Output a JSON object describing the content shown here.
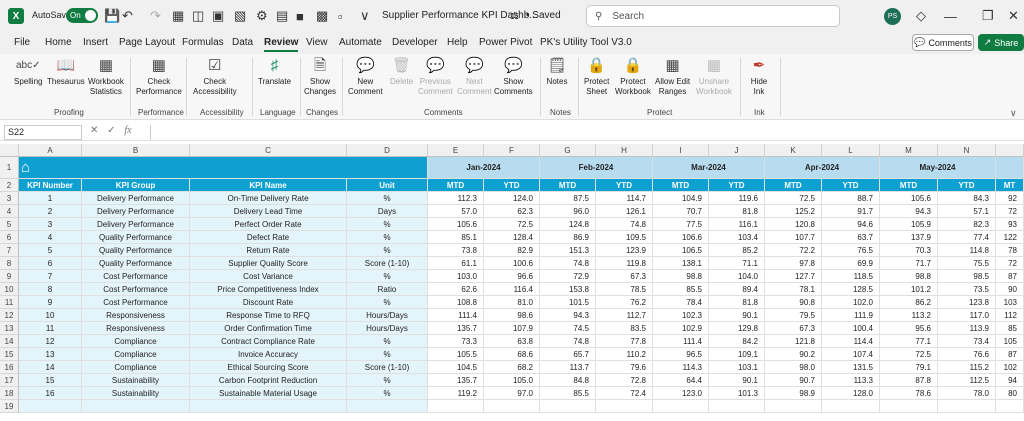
{
  "titlebar": {
    "app_logo": "X",
    "autosave_label": "AutoSave",
    "autosave_state": "On",
    "doc_title": "Supplier Performance KPI Dashb...",
    "saved_status": "• Saved",
    "search_placeholder": "Search",
    "avatar_initials": "PS"
  },
  "menu": [
    "File",
    "Home",
    "Insert",
    "Page Layout",
    "Formulas",
    "Data",
    "Review",
    "View",
    "Automate",
    "Developer",
    "Help",
    "Power Pivot",
    "PK's Utility Tool V3.0"
  ],
  "comments_label": "Comments",
  "share_label": "Share",
  "ribbon": {
    "spelling": "Spelling",
    "thesaurus": "Thesaurus",
    "workbook_stats_1": "Workbook",
    "workbook_stats_2": "Statistics",
    "check_perf_1": "Check",
    "check_perf_2": "Performance",
    "check_access_1": "Check",
    "check_access_2": "Accessibility",
    "translate": "Translate",
    "show_changes_1": "Show",
    "show_changes_2": "Changes",
    "new_comment_1": "New",
    "new_comment_2": "Comment",
    "delete": "Delete",
    "previous_1": "Previous",
    "previous_2": "Comment",
    "next_1": "Next",
    "next_2": "Comment",
    "show_comments_1": "Show",
    "show_comments_2": "Comments",
    "notes": "Notes",
    "protect_sheet_1": "Protect",
    "protect_sheet_2": "Sheet",
    "protect_wb_1": "Protect",
    "protect_wb_2": "Workbook",
    "allow_edit_1": "Allow Edit",
    "allow_edit_2": "Ranges",
    "unshare_1": "Unshare",
    "unshare_2": "Workbook",
    "hide_ink_1": "Hide",
    "hide_ink_2": "Ink",
    "groups": {
      "proofing": "Proofing",
      "performance": "Performance",
      "accessibility": "Accessibility",
      "language": "Language",
      "changes": "Changes",
      "comments": "Comments",
      "notes": "Notes",
      "protect": "Protect",
      "ink": "Ink"
    }
  },
  "formula_bar": {
    "name_box": "S22",
    "fx": "fx"
  },
  "columns": [
    "A",
    "B",
    "C",
    "D",
    "E",
    "F",
    "G",
    "H",
    "I",
    "J",
    "K",
    "L",
    "M",
    "N"
  ],
  "rows": [
    "1",
    "2",
    "3",
    "4",
    "5",
    "6",
    "7",
    "8",
    "9",
    "10",
    "11",
    "12",
    "13",
    "14",
    "15",
    "16",
    "17",
    "18",
    "19"
  ],
  "months": [
    "Jan-2024",
    "Feb-2024",
    "Mar-2024",
    "Apr-2024",
    "May-2024"
  ],
  "header": [
    "KPI Number",
    "KPI Group",
    "KPI Name",
    "Unit",
    "MTD",
    "YTD",
    "MTD",
    "YTD",
    "MTD",
    "YTD",
    "MTD",
    "YTD",
    "MTD",
    "YTD",
    "MT"
  ],
  "table": [
    [
      "1",
      "Delivery Performance",
      "On-Time Delivery Rate",
      "%",
      "112.3",
      "124.0",
      "87.5",
      "114.7",
      "104.9",
      "119.6",
      "72.5",
      "88.7",
      "105.6",
      "84.3",
      "92"
    ],
    [
      "2",
      "Delivery Performance",
      "Delivery Lead Time",
      "Days",
      "57.0",
      "62.3",
      "96.0",
      "126.1",
      "70.7",
      "81.8",
      "125.2",
      "91.7",
      "94.3",
      "57.1",
      "72"
    ],
    [
      "3",
      "Delivery Performance",
      "Perfect Order Rate",
      "%",
      "105.6",
      "72.5",
      "124.8",
      "74.8",
      "77.5",
      "116.1",
      "120.8",
      "94.6",
      "105.9",
      "82.3",
      "93"
    ],
    [
      "4",
      "Quality Performance",
      "Defect Rate",
      "%",
      "85.1",
      "128.4",
      "86.9",
      "109.5",
      "106.6",
      "103.4",
      "107.7",
      "63.7",
      "137.9",
      "77.4",
      "122"
    ],
    [
      "5",
      "Quality Performance",
      "Return Rate",
      "%",
      "73.8",
      "82.9",
      "151.3",
      "123.9",
      "106.5",
      "85.2",
      "72.2",
      "76.5",
      "70.3",
      "114.8",
      "78"
    ],
    [
      "6",
      "Quality Performance",
      "Supplier Quality Score",
      "Score (1-10)",
      "61.1",
      "100.6",
      "74.8",
      "119.8",
      "138.1",
      "71.1",
      "97.8",
      "69.9",
      "71.7",
      "75.5",
      "72"
    ],
    [
      "7",
      "Cost Performance",
      "Cost Variance",
      "%",
      "103.0",
      "96.6",
      "72.9",
      "67.3",
      "98.8",
      "104.0",
      "127.7",
      "118.5",
      "98.8",
      "98.5",
      "87"
    ],
    [
      "8",
      "Cost Performance",
      "Price Competitiveness Index",
      "Ratio",
      "62.6",
      "116.4",
      "153.8",
      "78.5",
      "85.5",
      "89.4",
      "78.1",
      "128.5",
      "101.2",
      "73.5",
      "90"
    ],
    [
      "9",
      "Cost Performance",
      "Discount Rate",
      "%",
      "108.8",
      "81.0",
      "101.5",
      "76.2",
      "78.4",
      "81.8",
      "90.8",
      "102.0",
      "86.2",
      "123.8",
      "103"
    ],
    [
      "10",
      "Responsiveness",
      "Response Time to RFQ",
      "Hours/Days",
      "111.4",
      "98.6",
      "94.3",
      "112.7",
      "102.3",
      "90.1",
      "79.5",
      "111.9",
      "113.2",
      "117.0",
      "112"
    ],
    [
      "11",
      "Responsiveness",
      "Order Confirmation Time",
      "Hours/Days",
      "135.7",
      "107.9",
      "74.5",
      "83.5",
      "102.9",
      "129.8",
      "67.3",
      "100.4",
      "95.6",
      "113.9",
      "85"
    ],
    [
      "12",
      "Compliance",
      "Contract Compliance Rate",
      "%",
      "73.3",
      "63.8",
      "74.8",
      "77.8",
      "111.4",
      "84.2",
      "121.8",
      "114.4",
      "77.1",
      "73.4",
      "105"
    ],
    [
      "13",
      "Compliance",
      "Invoice Accuracy",
      "%",
      "105.5",
      "68.6",
      "65.7",
      "110.2",
      "96.5",
      "109.1",
      "90.2",
      "107.4",
      "72.5",
      "76.6",
      "87"
    ],
    [
      "14",
      "Compliance",
      "Ethical Sourcing Score",
      "Score (1-10)",
      "104.5",
      "68.2",
      "113.7",
      "79.6",
      "114.3",
      "103.1",
      "98.0",
      "131.5",
      "79.1",
      "115.2",
      "102"
    ],
    [
      "15",
      "Sustainability",
      "Carbon Footprint Reduction",
      "%",
      "135.7",
      "105.0",
      "84.8",
      "72.8",
      "64.4",
      "90.1",
      "90.7",
      "113.3",
      "87.8",
      "112.5",
      "94"
    ],
    [
      "16",
      "Sustainability",
      "Sustainable Material Usage",
      "%",
      "119.2",
      "97.0",
      "85.5",
      "72.4",
      "123.0",
      "101.3",
      "98.9",
      "128.0",
      "78.6",
      "78.0",
      "80"
    ]
  ]
}
